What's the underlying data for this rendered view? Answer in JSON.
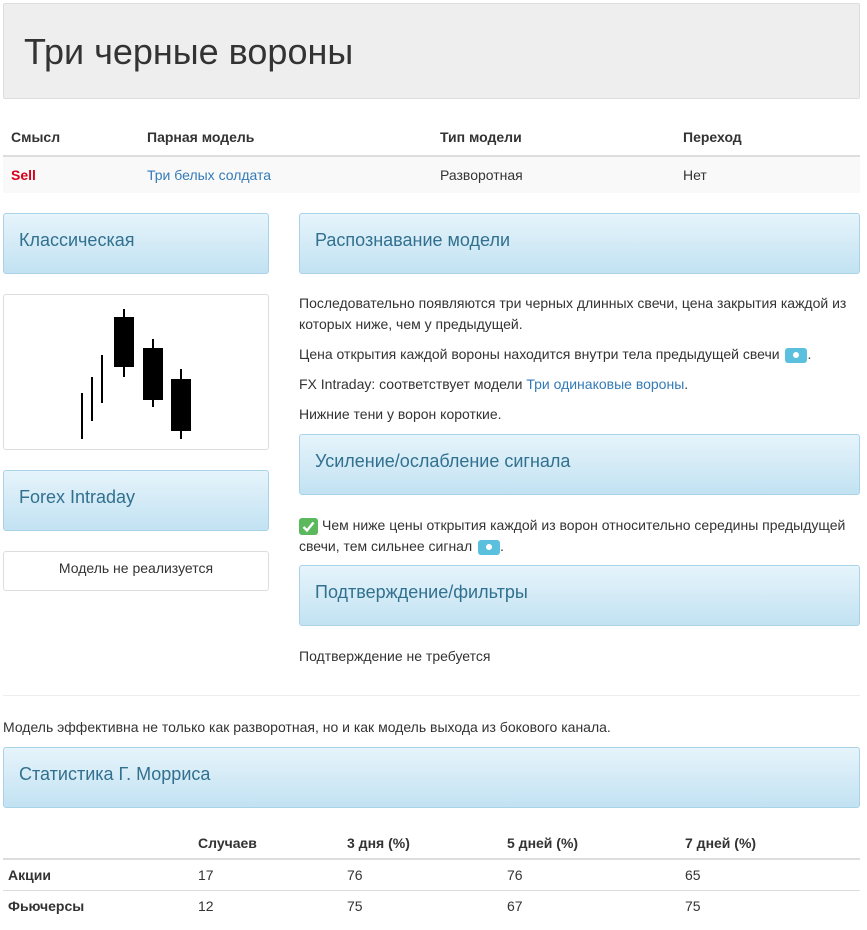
{
  "page": {
    "title": "Три черные вороны"
  },
  "properties": {
    "headers": [
      "Смысл",
      "Парная модель",
      "Тип модели",
      "Переход"
    ],
    "row": {
      "meaning": "Sell",
      "paired": "Три белых солдата",
      "type": "Разворотная",
      "transition": "Нет"
    }
  },
  "left": {
    "classic_title": "Классическая",
    "forex_title": "Forex Intraday",
    "forex_text": "Модель не реализуется"
  },
  "recognition": {
    "title": "Распознавание модели",
    "p1": "Последовательно появляются три черных длинных свечи, цена закрытия каждой из которых ниже, чем у предыдущей.",
    "p2": "Цена открытия каждой вороны находится внутри тела предыдущей свечи",
    "p3_prefix": "FX Intraday: соответствует модели ",
    "p3_link": "Три одинаковые вороны",
    "p3_suffix": ".",
    "p4": "Нижние тени у ворон короткие."
  },
  "signal": {
    "title": "Усиление/ослабление сигнала",
    "text": "Чем ниже цены открытия каждой из ворон относительно середины предыдущей свечи, тем сильнее сигнал"
  },
  "confirmation": {
    "title": "Подтверждение/фильтры",
    "text": "Подтверждение не требуется"
  },
  "note": "Модель эффективна не только как разворотная, но и как модель выхода из бокового канала.",
  "stats": {
    "title": "Статистика Г. Морриса",
    "headers": [
      "",
      "Случаев",
      "3 дня (%)",
      "5 дней (%)",
      "7 дней (%)"
    ],
    "rows": [
      {
        "name": "Акции",
        "cases": "17",
        "d3": "76",
        "d5": "76",
        "d7": "65"
      },
      {
        "name": "Фьючерсы",
        "cases": "12",
        "d3": "75",
        "d5": "67",
        "d7": "75"
      }
    ]
  },
  "colors": {
    "sell": "#d9001c",
    "link": "#337ab7",
    "panel_title": "#31708f",
    "info": "#5bc0de",
    "check": "#5cb85c"
  },
  "icons": {
    "info": "info-icon",
    "check": "check-icon"
  }
}
